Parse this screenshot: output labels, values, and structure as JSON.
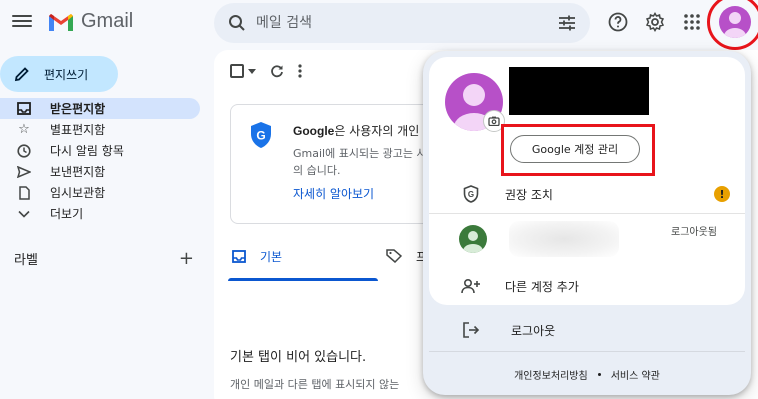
{
  "header": {
    "app_name": "Gmail",
    "search_placeholder": "메일 검색",
    "icons": [
      "menu-icon",
      "search-icon",
      "filter-options-icon",
      "help-icon",
      "settings-icon",
      "apps-icon",
      "account-avatar"
    ]
  },
  "sidebar": {
    "compose_label": "편지쓰기",
    "items": [
      {
        "label": "받은편지함",
        "icon": "inbox-icon",
        "active": true
      },
      {
        "label": "별표편지함",
        "icon": "star-icon",
        "active": false
      },
      {
        "label": "다시 알림 항목",
        "icon": "clock-icon",
        "active": false
      },
      {
        "label": "보낸편지함",
        "icon": "send-icon",
        "active": false
      },
      {
        "label": "임시보관함",
        "icon": "draft-icon",
        "active": false
      },
      {
        "label": "더보기",
        "icon": "chevron-down-icon",
        "active": false
      }
    ],
    "labels_title": "라벨",
    "labels_add": "+"
  },
  "main": {
    "promo": {
      "title_brand": "Google",
      "title_rest": "은 사용자의 개인",
      "body": "Gmail에 표시되는 광고는 사용자의 습니다.",
      "link": "자세히 알아보기"
    },
    "tabs": [
      {
        "label": "기본",
        "icon": "inbox-icon",
        "active": true
      },
      {
        "label": "프",
        "icon": "tag-icon",
        "active": false
      }
    ],
    "empty_title": "기본 탭이 비어 있습니다.",
    "empty_sub": "개인 메일과 다른 탭에 표시되지 않는"
  },
  "account_menu": {
    "manage_button": "Google 계정 관리",
    "security_label": "권장 조치",
    "security_badge": "!",
    "other_account_status": "로그아웃됨",
    "add_account_label": "다른 계정 추가",
    "sign_out_label": "로그아웃",
    "footer_privacy": "개인정보처리방침",
    "footer_terms": "서비스 약관"
  },
  "colors": {
    "brand_red": "#ea4335",
    "highlight_red": "#e8141b",
    "compose_bg": "#c2e7ff",
    "active_nav_bg": "#d3e3fd",
    "link_blue": "#0b57d0",
    "avatar_purple": "#b750c8",
    "warning_amber": "#e8a000"
  }
}
